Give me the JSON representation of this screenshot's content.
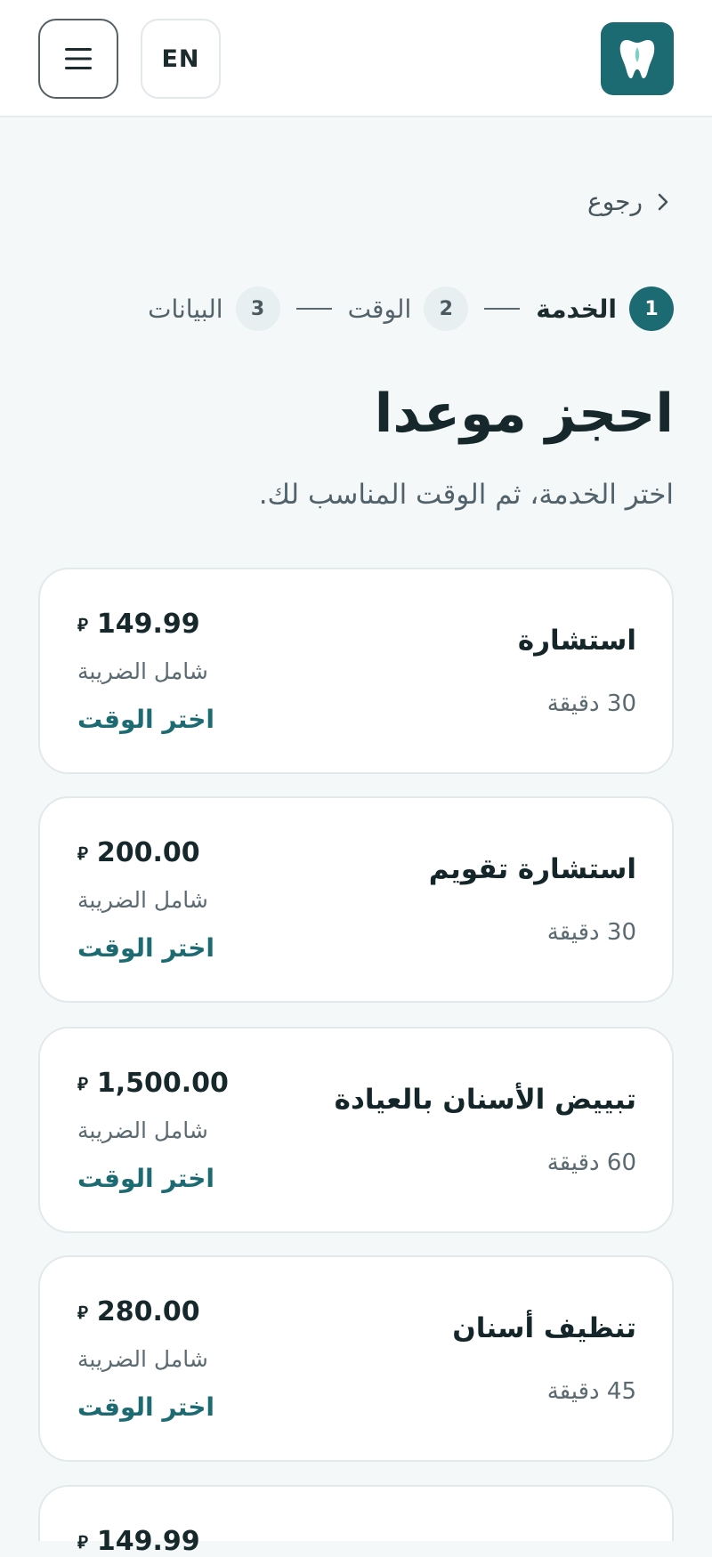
{
  "header": {
    "language_label": "EN",
    "menu_icon": "hamburger-menu-icon",
    "logo_icon": "tooth-icon",
    "brand_color": "#1d6b72"
  },
  "back": {
    "label": "رجوع",
    "icon": "chevron-right-icon"
  },
  "steps": [
    {
      "number": "1",
      "label": "الخدمة",
      "active": true
    },
    {
      "number": "2",
      "label": "الوقت",
      "active": false
    },
    {
      "number": "3",
      "label": "البيانات",
      "active": false
    }
  ],
  "page": {
    "title": "احجز موعدا",
    "subtitle": "اختر الخدمة، ثم الوقت المناسب لك."
  },
  "services": [
    {
      "name": "استشارة",
      "duration": "30 دقيقة",
      "price": "149.99",
      "currency": "⃁",
      "tax_note": "شامل الضريبة",
      "action": "اختر الوقت"
    },
    {
      "name": "استشارة تقويم",
      "duration": "30 دقيقة",
      "price": "200.00",
      "currency": "⃁",
      "tax_note": "شامل الضريبة",
      "action": "اختر الوقت"
    },
    {
      "name": "تبييض الأسنان بالعيادة",
      "duration": "60 دقيقة",
      "price": "1,500.00",
      "currency": "⃁",
      "tax_note": "شامل الضريبة",
      "action": "اختر الوقت"
    },
    {
      "name": "تنظيف أسنان",
      "duration": "45 دقيقة",
      "price": "280.00",
      "currency": "⃁",
      "tax_note": "شامل الضريبة",
      "action": "اختر الوقت"
    },
    {
      "name": "",
      "duration": "",
      "price": "149.99",
      "currency": "⃁",
      "tax_note": "",
      "action": ""
    }
  ]
}
